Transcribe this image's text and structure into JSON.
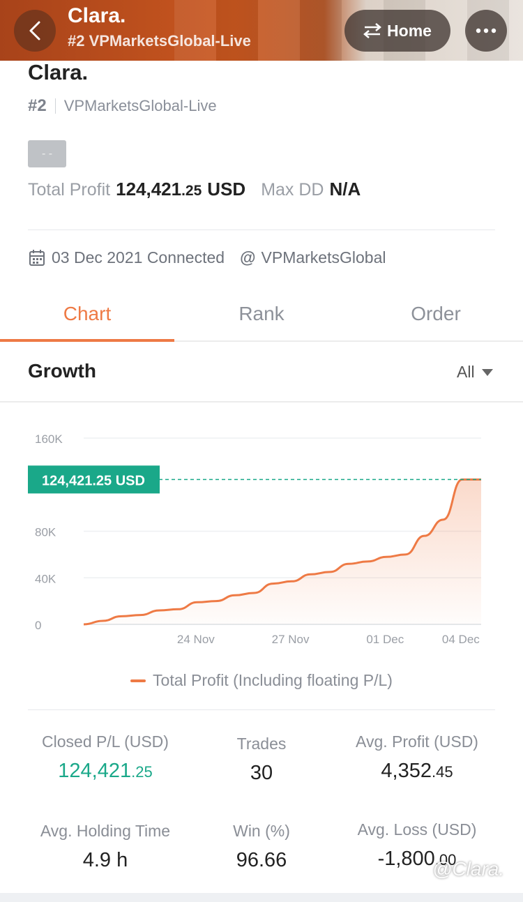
{
  "nav": {
    "title": "Clara.",
    "subtitle": "#2 VPMarketsGlobal-Live",
    "home_label": "Home"
  },
  "profile": {
    "name": "Clara.",
    "rank": "#2",
    "server": "VPMarketsGlobal-Live",
    "badge": "- -",
    "total_profit_label": "Total Profit",
    "total_profit_int": "124,421",
    "total_profit_dec": ".25",
    "total_profit_unit": "USD",
    "max_dd_label": "Max DD",
    "max_dd_value": "N/A",
    "connected": "03 Dec 2021 Connected",
    "broker": "VPMarketsGlobal"
  },
  "tabs": [
    {
      "label": "Chart",
      "active": true
    },
    {
      "label": "Rank",
      "active": false
    },
    {
      "label": "Order",
      "active": false
    }
  ],
  "growth": {
    "title": "Growth",
    "filter": "All"
  },
  "chart_data": {
    "type": "area",
    "title": "",
    "xlabel": "",
    "ylabel": "",
    "ylim": [
      0,
      160000
    ],
    "yticks": [
      "160K",
      "80K",
      "40K",
      "0"
    ],
    "ytick_values": [
      160000,
      80000,
      40000,
      0
    ],
    "xticks": [
      "24 Nov",
      "27 Nov",
      "01 Dec",
      "04 Dec"
    ],
    "xtick_index": [
      6,
      11,
      16,
      20
    ],
    "marker_label": "124,421.25 USD",
    "marker_value": 124421.25,
    "grid": true,
    "series": [
      {
        "name": "Total Profit (Including floating P/L)",
        "values": [
          0,
          3000,
          7000,
          8000,
          12000,
          13000,
          19000,
          20000,
          25000,
          27000,
          35000,
          37000,
          43000,
          45000,
          52000,
          54000,
          58000,
          60000,
          76000,
          90000,
          124421.25,
          124421.25
        ]
      }
    ],
    "legend": "bottom-center",
    "color": "#ee7a45"
  },
  "stats": {
    "closed_pl": {
      "label": "Closed P/L (USD)",
      "int": "124,421",
      "dec": ".25"
    },
    "trades": {
      "label": "Trades",
      "value": "30"
    },
    "avg_profit": {
      "label": "Avg. Profit (USD)",
      "int": "4,352",
      "dec": ".45"
    },
    "avg_holding": {
      "label": "Avg. Holding Time",
      "value": "4.9 h"
    },
    "win": {
      "label": "Win (%)",
      "value": "96.66"
    },
    "avg_loss": {
      "label": "Avg. Loss (USD)",
      "int": "-1,800",
      "dec": ".00"
    }
  },
  "watermark": "@Clara."
}
